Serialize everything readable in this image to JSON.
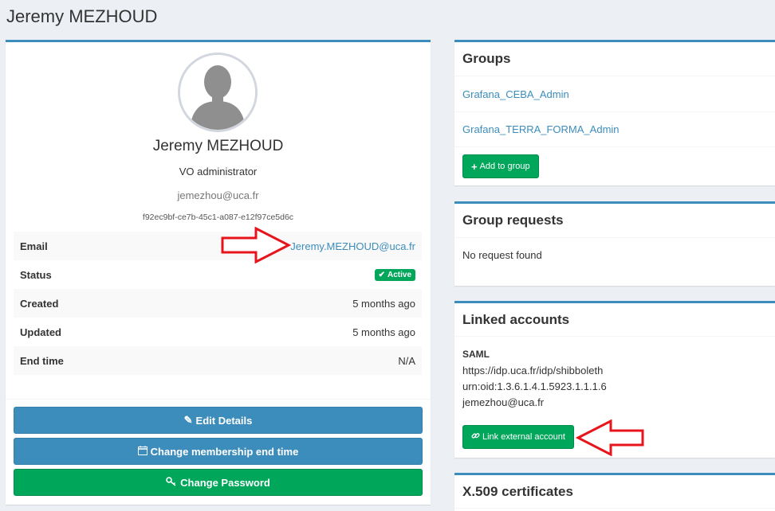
{
  "page": {
    "title": "Jeremy MEZHOUD"
  },
  "profile": {
    "name": "Jeremy MEZHOUD",
    "role": "VO administrator",
    "username": "jemezhou@uca.fr",
    "uuid": "f92ec9bf-ce7b-45c1-a087-e12f97ce5d6c",
    "fields": {
      "email_label": "Email",
      "email_value": "Jeremy.MEZHOUD@uca.fr",
      "status_label": "Status",
      "status_value": "Active",
      "created_label": "Created",
      "created_value": "5 months ago",
      "updated_label": "Updated",
      "updated_value": "5 months ago",
      "endtime_label": "End time",
      "endtime_value": "N/A"
    },
    "buttons": {
      "edit": "Edit Details",
      "membership": "Change membership end time",
      "password": "Change Password"
    }
  },
  "groups": {
    "title": "Groups",
    "items": [
      "Grafana_CEBA_Admin",
      "Grafana_TERRA_FORMA_Admin"
    ],
    "add_button": "Add to group"
  },
  "group_requests": {
    "title": "Group requests",
    "empty": "No request found"
  },
  "linked_accounts": {
    "title": "Linked accounts",
    "type": "SAML",
    "idp": "https://idp.uca.fr/idp/shibboleth",
    "attribute": "urn:oid:1.3.6.1.4.1.5923.1.1.1.6",
    "value": "jemezhou@uca.fr",
    "link_button": "Link external account"
  },
  "certificates": {
    "title": "X.509 certificates"
  },
  "colors": {
    "primary": "#3c8dbc",
    "success": "#00a65a",
    "annotation": "#e8141b"
  }
}
